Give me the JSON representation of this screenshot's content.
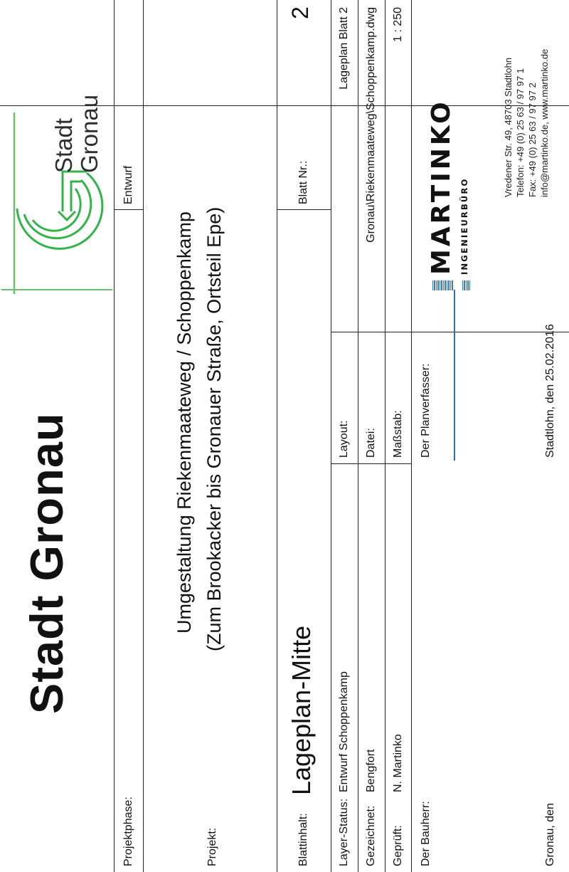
{
  "header": {
    "title": "Stadt Gronau",
    "logo_text_line1": "Stadt",
    "logo_text_line2": "Gronau"
  },
  "rows": {
    "projektphase": {
      "label": "Projektphase:",
      "value": "Entwurf"
    },
    "projekt": {
      "label": "Projekt:",
      "line1": "Umgestaltung Riekenmaateweg / Schoppenkamp",
      "line2": "(Zum Brookacker bis Gronauer Straße, Ortsteil Epe)"
    },
    "blattinhalt": {
      "label": "Blattinhalt:",
      "value": "Lageplan-Mitte",
      "blatt_nr_label": "Blatt Nr.:",
      "blatt_nr": "2"
    },
    "layer_status": {
      "label": "Layer-Status:",
      "value": "Entwurf Schoppenkamp",
      "layout_label": "Layout:",
      "layout_value": "Lageplan Blatt  2"
    },
    "gezeichnet": {
      "label": "Gezeichnet:",
      "value": "Bengfort",
      "datei_label": "Datei:",
      "datei_value": "Gronau\\Riekenmaateweg\\Schoppenkamp.dwg"
    },
    "geprueft": {
      "label": "Geprüft:",
      "value": "N. Martinko",
      "massstab_label": "Maßstab:",
      "massstab_value": "1 : 250"
    },
    "bauherr": {
      "label": "Der Bauherr:",
      "place_date": "Gronau, den"
    },
    "planverfasser": {
      "label": "Der Planverfasser:",
      "place_date": "Stadtlohn, den 25.02.2016"
    }
  },
  "martinko": {
    "name": "MARTINKO",
    "subtitle": "INGENIEURBÜRO",
    "address": [
      "Vredener Str. 49, 48703 Stadtlohn",
      "Telefon: +49 (0) 25 63 / 97 97 1",
      "Fax: +49 (0) 25 63 /  97 97 2",
      "info@martinko.de, www.martinko.de"
    ]
  },
  "colors": {
    "logo_green": "#34b34a",
    "logo_blue_line": "#2f6db5"
  }
}
